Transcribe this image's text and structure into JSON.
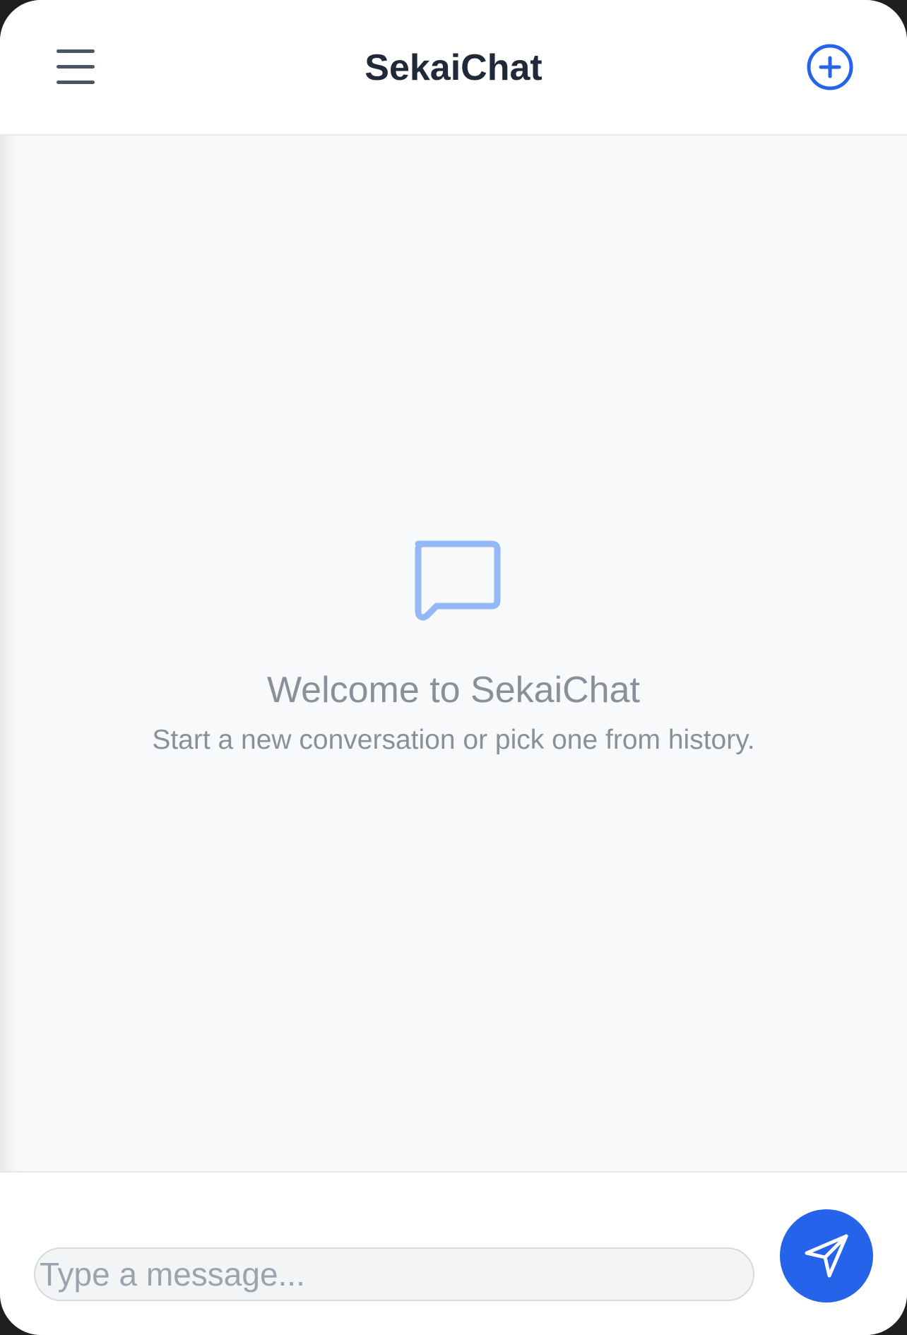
{
  "app": {
    "title": "SekaiChat"
  },
  "header": {
    "menu_icon": "hamburger-menu-icon",
    "new_chat_icon": "plus-circle-icon"
  },
  "empty_state": {
    "icon": "chat-bubble-icon",
    "heading": "Welcome to SekaiChat",
    "subtext": "Start a new conversation or pick one from history."
  },
  "composer": {
    "placeholder": "Type a message...",
    "value": "",
    "send_icon": "paper-plane-icon"
  },
  "colors": {
    "accent": "#2563eb",
    "icon_light": "#93b8f6",
    "title": "#1f2937",
    "muted_text": "#8a8f99",
    "background": "#f8f9fb"
  }
}
